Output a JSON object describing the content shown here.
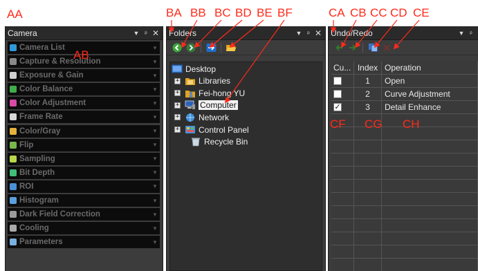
{
  "annotations": {
    "aa": "AA",
    "ab": "AB",
    "ba": "BA",
    "bb": "BB",
    "bc": "BC",
    "bd": "BD",
    "be": "BE",
    "bf": "BF",
    "ca": "CA",
    "cb": "CB",
    "cc": "CC",
    "cd": "CD",
    "ce": "CE",
    "cf": "CF",
    "cg": "CG",
    "ch": "CH"
  },
  "camera": {
    "title": "Camera",
    "header_buttons": [
      "▼",
      "ᵖ",
      "✕"
    ],
    "items": [
      {
        "label": "Camera List",
        "icon": "camera-list-icon",
        "color": "#2f9ad8"
      },
      {
        "label": "Capture & Resolution",
        "icon": "capture-icon",
        "color": "#8a8a8a"
      },
      {
        "label": "Exposure & Gain",
        "icon": "exposure-icon",
        "color": "#d0d0d0"
      },
      {
        "label": "Color Balance",
        "icon": "color-balance-icon",
        "color": "#3fae49"
      },
      {
        "label": "Color Adjustment",
        "icon": "color-adjustment-icon",
        "color": "#d84aa6"
      },
      {
        "label": "Frame Rate",
        "icon": "frame-rate-icon",
        "color": "#d8d8d8"
      },
      {
        "label": "Color/Gray",
        "icon": "color-gray-icon",
        "color": "#e6b23c"
      },
      {
        "label": "Flip",
        "icon": "flip-icon",
        "color": "#77b84a"
      },
      {
        "label": "Sampling",
        "icon": "sampling-icon",
        "color": "#b8d84a"
      },
      {
        "label": "Bit Depth",
        "icon": "bit-depth-icon",
        "color": "#3fbf7a"
      },
      {
        "label": "ROI",
        "icon": "roi-icon",
        "color": "#4a90d8"
      },
      {
        "label": "Histogram",
        "icon": "histogram-icon",
        "color": "#5aa0e0"
      },
      {
        "label": "Dark Field Correction",
        "icon": "dark-field-icon",
        "color": "#9a9a9a"
      },
      {
        "label": "Cooling",
        "icon": "cooling-icon",
        "color": "#aaaaaa"
      },
      {
        "label": "Parameters",
        "icon": "parameters-icon",
        "color": "#7ab0e0"
      }
    ]
  },
  "folders": {
    "title": "Folders",
    "toolbar": [
      "back-icon",
      "forward-icon",
      "go-icon",
      "open-folder-icon"
    ],
    "tree": [
      {
        "label": "Desktop",
        "icon": "desktop-icon",
        "expander": false
      },
      {
        "label": "Libraries",
        "icon": "libraries-icon",
        "expander": true
      },
      {
        "label": "Fei-hong YU",
        "icon": "user-folder-icon",
        "expander": true
      },
      {
        "label": "Computer",
        "icon": "computer-icon",
        "expander": true,
        "selected": true
      },
      {
        "label": "Network",
        "icon": "network-icon",
        "expander": true
      },
      {
        "label": "Control Panel",
        "icon": "control-panel-icon",
        "expander": true
      },
      {
        "label": "Recycle Bin",
        "icon": "recycle-bin-icon",
        "expander": false
      }
    ],
    "expander_glyph": "+"
  },
  "undo": {
    "title": "Undo/Redo",
    "toolbar": [
      "undo-icon",
      "redo-icon",
      "copy-icon",
      "clear-icon"
    ],
    "columns": [
      "Cu...",
      "Index",
      "Operation"
    ],
    "rows": [
      {
        "checked": false,
        "index": "1",
        "operation": "Open"
      },
      {
        "checked": false,
        "index": "2",
        "operation": "Curve Adjustment"
      },
      {
        "checked": true,
        "index": "3",
        "operation": "Detail Enhance"
      }
    ],
    "check_glyph": "✓",
    "empty_rows": 12
  },
  "colors": {
    "annotation": "#ff2a1a",
    "arrow": "#ff2a1a",
    "pane_bg": "#3c3c3c",
    "header_bg": "#2a2a2a"
  }
}
